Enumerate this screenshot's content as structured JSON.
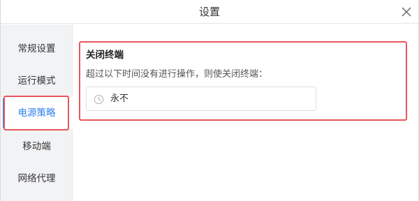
{
  "dialog": {
    "title": "设置"
  },
  "sidebar": {
    "items": [
      {
        "label": "常规设置"
      },
      {
        "label": "运行模式"
      },
      {
        "label": "电源策略"
      },
      {
        "label": "移动端"
      },
      {
        "label": "网络代理"
      }
    ],
    "active_index": 2
  },
  "power": {
    "section_title": "关闭终端",
    "description": "超过以下时间没有进行操作，则使关闭终端：",
    "selected_value": "永不"
  },
  "colors": {
    "accent": "#2f7ee8",
    "highlight": "#e8565e",
    "sidebar_bg": "#f2f3f5"
  },
  "icons": {
    "close": "close-icon",
    "clock": "clock-icon"
  }
}
